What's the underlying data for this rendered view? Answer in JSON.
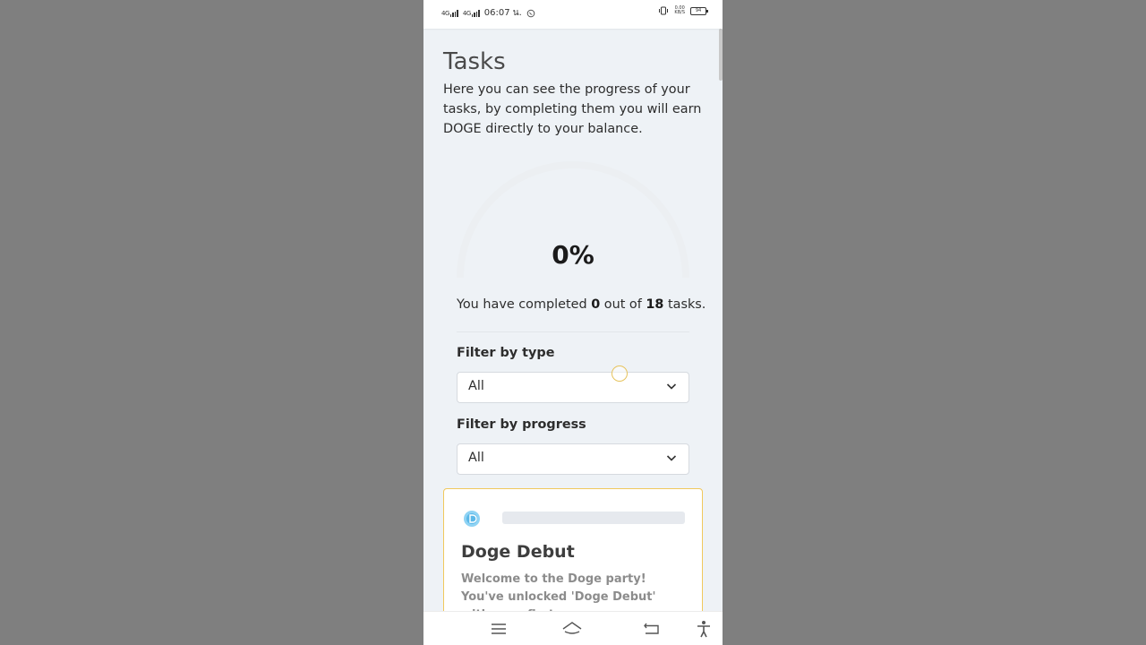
{
  "status_bar": {
    "network_1": "4G",
    "network_2": "4G",
    "time": "06:07 น.",
    "app_icon": "whatsapp-icon",
    "net_speed": "0.00",
    "net_speed_unit": "KB/S",
    "battery_level": "94"
  },
  "page": {
    "title": "Tasks",
    "intro": "Here you can see the progress of your tasks, by completing them you will earn DOGE directly to your balance."
  },
  "progress": {
    "percent_label": "0%",
    "percent_value": 0,
    "text_prefix": "You have completed ",
    "completed": "0",
    "text_middle": " out of ",
    "total": "18",
    "text_suffix": " tasks."
  },
  "filters": {
    "type_label": "Filter by type",
    "type_value": "All",
    "progress_label": "Filter by progress",
    "progress_value": "All"
  },
  "task_card": {
    "icon": "doge-coin-icon",
    "title": "Doge Debut",
    "description": "Welcome to the Doge party! You've unlocked 'Doge Debut' with your first"
  },
  "nav_bar": {
    "items": [
      "menu-icon",
      "home-icon",
      "back-icon",
      "accessibility-icon"
    ]
  },
  "colors": {
    "accent_border": "#f0c85c",
    "gauge_track": "#eceff2",
    "background": "#eef2f6"
  }
}
